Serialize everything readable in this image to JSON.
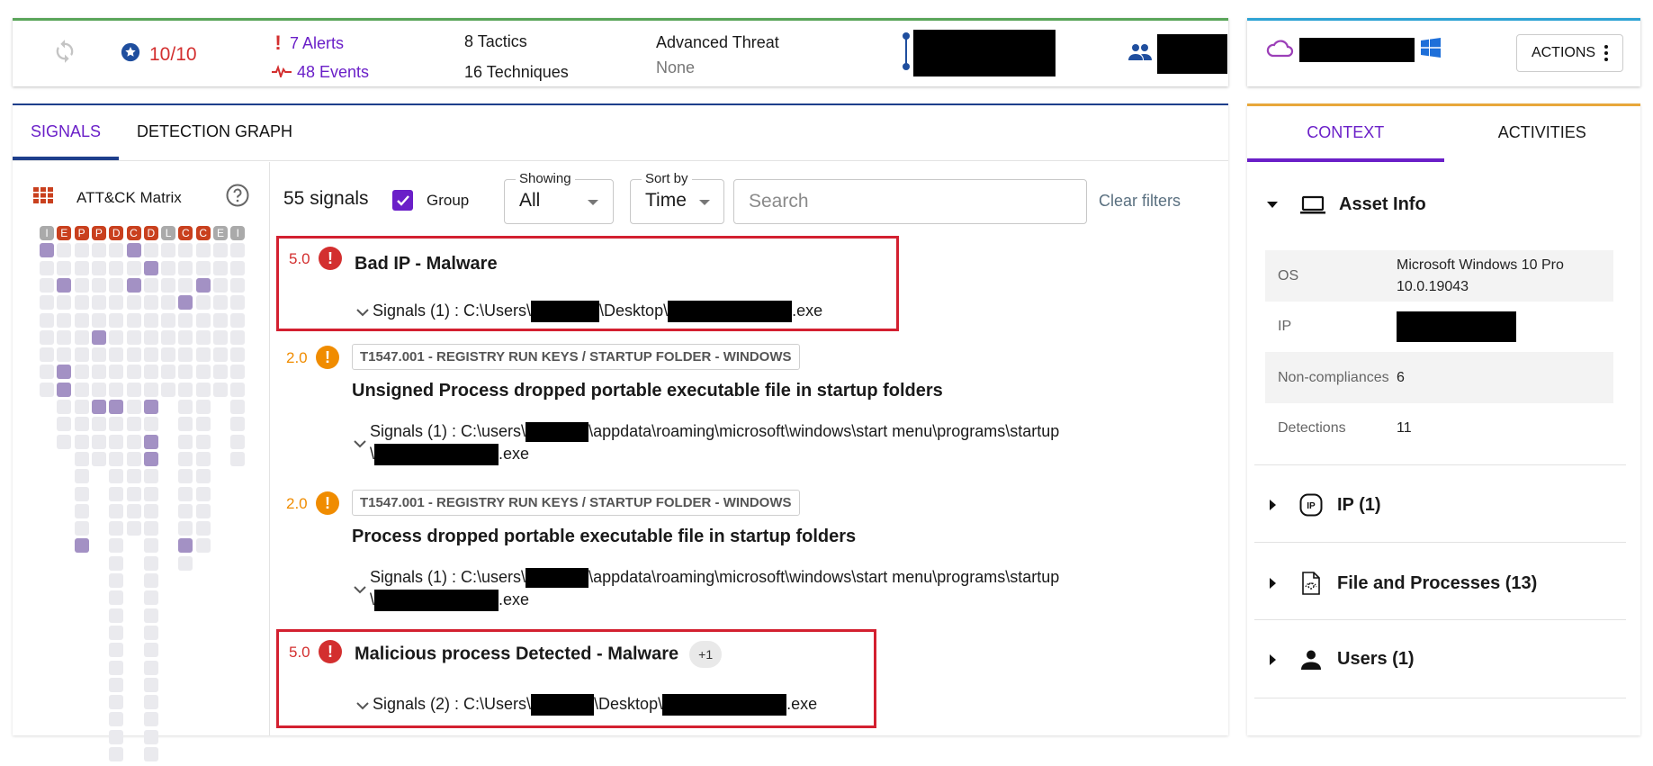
{
  "summary": {
    "score": "10/10",
    "alerts": "7 Alerts",
    "events": "48 Events",
    "tactics_count": "8",
    "tactics_label": "Tactics",
    "techniques_count": "16",
    "techniques_label": "Techniques",
    "threat_title": "Advanced Threat",
    "threat_value": "None"
  },
  "asset_bar": {
    "actions_label": "ACTIONS"
  },
  "main": {
    "tabs": [
      {
        "label": "SIGNALS",
        "active": true
      },
      {
        "label": "DETECTION GRAPH",
        "active": false
      }
    ],
    "matrix": {
      "title": "ATT&CK Matrix",
      "columns": [
        {
          "letter": "I",
          "hot": false,
          "cells": 9,
          "highlighted": [
            0
          ]
        },
        {
          "letter": "E",
          "hot": true,
          "cells": 12,
          "highlighted": [
            2,
            7,
            8
          ]
        },
        {
          "letter": "P",
          "hot": true,
          "cells": 18,
          "highlighted": [
            17
          ]
        },
        {
          "letter": "P",
          "hot": true,
          "cells": 13,
          "highlighted": [
            5,
            9
          ]
        },
        {
          "letter": "D",
          "hot": true,
          "cells": 30,
          "highlighted": [
            9
          ]
        },
        {
          "letter": "C",
          "hot": true,
          "cells": 17,
          "highlighted": [
            0,
            2
          ]
        },
        {
          "letter": "D",
          "hot": true,
          "cells": 30,
          "highlighted": [
            1,
            9,
            11,
            12
          ]
        },
        {
          "letter": "L",
          "hot": false,
          "cells": 9,
          "highlighted": []
        },
        {
          "letter": "C",
          "hot": true,
          "cells": 19,
          "highlighted": [
            3,
            17
          ]
        },
        {
          "letter": "C",
          "hot": true,
          "cells": 18,
          "highlighted": [
            2
          ]
        },
        {
          "letter": "E",
          "hot": false,
          "cells": 9,
          "highlighted": []
        },
        {
          "letter": "I",
          "hot": false,
          "cells": 13,
          "highlighted": []
        }
      ]
    },
    "filters": {
      "signal_count": "55 signals",
      "group_label": "Group",
      "group_checked": true,
      "showing_legend": "Showing",
      "showing_value": "All",
      "sortby_legend": "Sort by",
      "sortby_value": "Time",
      "search_placeholder": "Search",
      "clear_label": "Clear filters"
    },
    "signals": [
      {
        "severity": "5.0",
        "level": "high",
        "title": "Bad IP - Malware",
        "path_prefix": "Signals (1) : C:\\Users\\",
        "path_mid": "\\Desktop\\",
        "path_suffix": ".exe"
      },
      {
        "severity": "2.0",
        "level": "medium",
        "technique": "T1547.001 - REGISTRY RUN KEYS / STARTUP FOLDER - WINDOWS",
        "title": "Unsigned Process dropped portable executable file in startup folders",
        "path_prefix": "Signals (1) : C:\\users\\",
        "path_mid": "\\appdata\\roaming\\microsoft\\windows\\start menu\\programs\\startup",
        "path_line2_prefix": "\\",
        "path_suffix": ".exe"
      },
      {
        "severity": "2.0",
        "level": "medium",
        "technique": "T1547.001 - REGISTRY RUN KEYS / STARTUP FOLDER - WINDOWS",
        "title": "Process dropped portable executable file in startup folders",
        "path_prefix": "Signals (1) : C:\\users\\",
        "path_mid": "\\appdata\\roaming\\microsoft\\windows\\start menu\\programs\\startup",
        "path_line2_prefix": "\\",
        "path_suffix": ".exe"
      },
      {
        "severity": "5.0",
        "level": "high",
        "title": "Malicious process Detected - Malware",
        "extra_badge": "+1",
        "path_prefix": "Signals (2) : C:\\Users\\",
        "path_mid": "\\Desktop\\",
        "path_suffix": ".exe"
      }
    ]
  },
  "right": {
    "tabs": [
      {
        "label": "CONTEXT",
        "active": true
      },
      {
        "label": "ACTIVITIES",
        "active": false
      }
    ],
    "asset_info": {
      "title": "Asset Info",
      "rows": [
        {
          "key": "OS",
          "value": "Microsoft Windows 10 Pro 10.0.19043"
        },
        {
          "key": "IP",
          "value": ""
        },
        {
          "key": "Non-compliances",
          "value": "6"
        },
        {
          "key": "Detections",
          "value": "11"
        }
      ]
    },
    "sections": [
      {
        "label": "IP (1)",
        "icon": "ip-icon"
      },
      {
        "label": "File and Processes (13)",
        "icon": "file-process-icon"
      },
      {
        "label": "Users (1)",
        "icon": "user-icon"
      }
    ]
  },
  "colors": {
    "accent_purple": "#6a1fc8",
    "severity_high": "#d32f2f",
    "severity_medium": "#f08c00",
    "matrix_hot": "#c9401e",
    "matrix_on": "#a391c4"
  }
}
